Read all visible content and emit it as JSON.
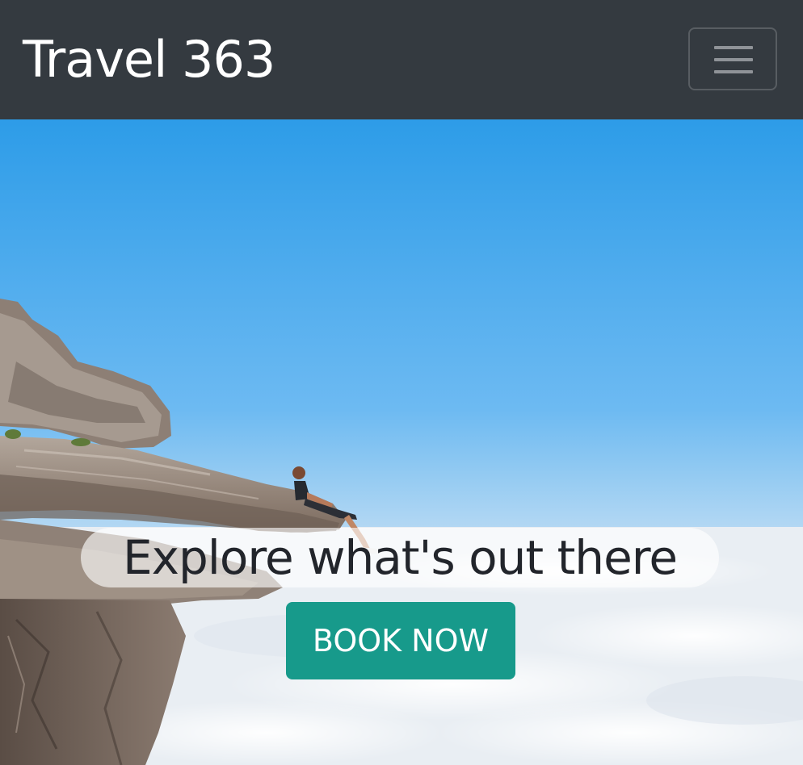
{
  "navbar": {
    "brand": "Travel 363",
    "toggler_icon": "hamburger-menu-icon",
    "background": "#343a40"
  },
  "hero": {
    "image": "person-sitting-on-cliff-above-clouds",
    "tagline": "Explore what's out there",
    "cta_label": "BOOK NOW",
    "cta_color": "#179a8b",
    "sky_color": "#4aa8ee"
  }
}
